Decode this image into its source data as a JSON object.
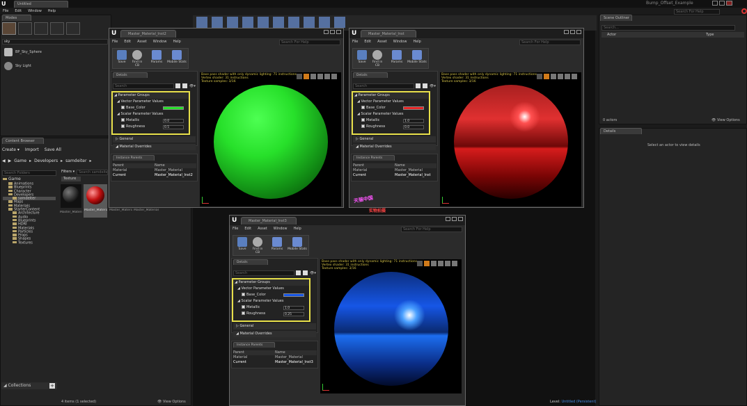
{
  "app": {
    "tab": "Untitled",
    "title": "Bump_Offset_Example",
    "search_help": "Search For Help"
  },
  "main_menu": [
    "File",
    "Edit",
    "Window",
    "Help"
  ],
  "modes": {
    "tab": "Modes",
    "search_value": "sky",
    "items": [
      "BP_Sky_Sphere",
      "Sky Light"
    ],
    "search_highlight": "sky"
  },
  "content_browser": {
    "tab": "Content Browser",
    "create": "Create",
    "import": "Import",
    "save_all": "Save All",
    "breadcrumbs": [
      "Game",
      "Developers",
      "samdeiter"
    ],
    "search_folders": "Search Folders",
    "filters": "Filters",
    "search_assets": "Search samdeiter",
    "texture_filter": "Texture",
    "tree": [
      "Game",
      "Animations",
      "Blueprints",
      "Character",
      "Developers",
      "samdeiter",
      "Maps",
      "Materials",
      "StarterContent",
      "Architecture",
      "Audio",
      "Blueprints",
      "HDRI",
      "Materials",
      "Particles",
      "Props",
      "Shapes",
      "Textures"
    ],
    "assets": [
      "Master_Material",
      "Master_Material_Inst",
      "Master_Material_Inst2",
      "Master_Material_Inst3"
    ],
    "collections": "Collections",
    "status": "4 items (1 selected)",
    "view_options": "View Options"
  },
  "world_outliner": {
    "tab": "Scene Outliner",
    "search": "Search...",
    "col_actor": "Actor",
    "col_type": "Type",
    "actors": "0 actors",
    "view_options": "View Options"
  },
  "details_side": {
    "tab": "Details",
    "message": "Select an actor to view details"
  },
  "status": {
    "level_label": "Level:",
    "level": "Untitled (Persistent)"
  },
  "watermark": {
    "line1": "天猫中国",
    "line2": "实物拍摄"
  },
  "editor": {
    "menu": [
      "File",
      "Edit",
      "Asset",
      "Window",
      "Help"
    ],
    "toolbar": [
      "Save",
      "Find in CB",
      "Params",
      "Mobile Stats"
    ],
    "details_tab": "Details",
    "search": "Search",
    "param_groups": "Parameter Groups",
    "vector_group": "Vector Parameter Values",
    "base_color": "Base_Color",
    "scalar_group": "Scalar Parameter Values",
    "metallic": "Metallic",
    "roughness": "Roughness",
    "general": "General",
    "material_overrides": "Material Overrides",
    "instance_parents": "Instance Parents",
    "col_parent": "Parent",
    "col_name": "Name",
    "row_parent": "Material",
    "row_current": "Current",
    "parent_name": "Master_Material",
    "viewport_info": [
      "Base pass shader with only dynamic lighting: 71 instructions",
      "Vertex shader: 31 instructions",
      "Texture samples: 3/16"
    ]
  },
  "instances": [
    {
      "tab": "Master_Material_Inst2",
      "name": "Master_Material_Inst2",
      "color": "#27e02a",
      "metallic": "0.0",
      "roughness": "0.5"
    },
    {
      "tab": "Master_Material_Inst",
      "name": "Master_Material_Inst",
      "color": "#e62626",
      "metallic": "1.0",
      "roughness": "0.0"
    },
    {
      "tab": "Master_Material_Inst3",
      "name": "Master_Material_Inst3",
      "color": "#1656e6",
      "metallic": "1.0",
      "roughness": "0.25"
    }
  ]
}
